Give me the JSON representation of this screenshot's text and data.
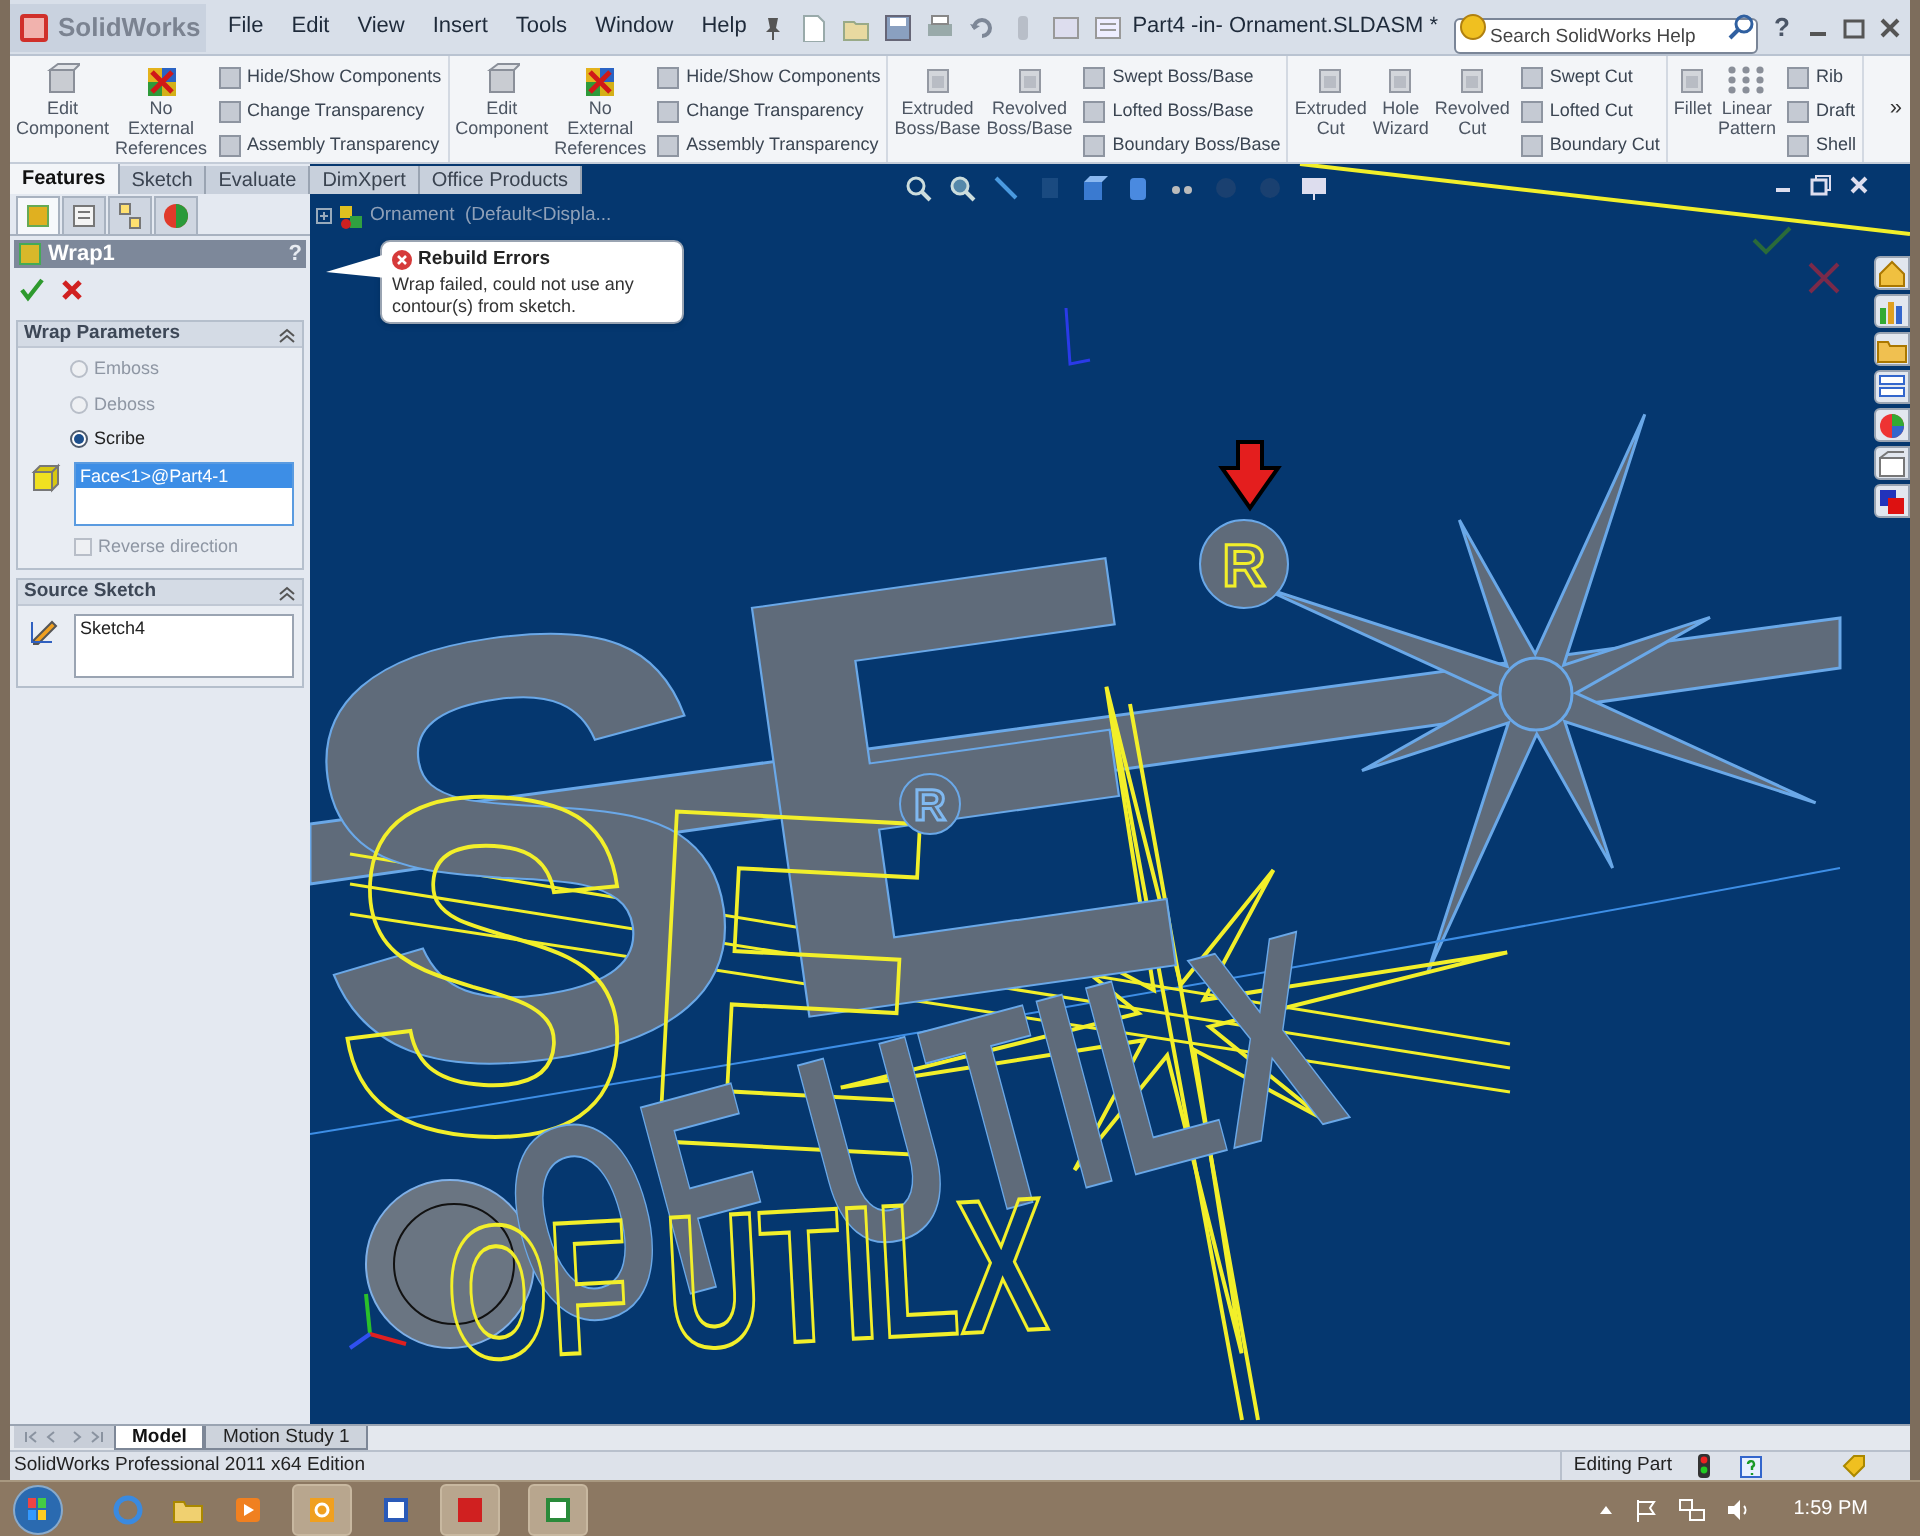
{
  "app": {
    "logo": "SolidWorks"
  },
  "menu": [
    "File",
    "Edit",
    "View",
    "Insert",
    "Tools",
    "Window",
    "Help"
  ],
  "window": {
    "title": "Part4 -in- Ornament.SLDASM *"
  },
  "search": {
    "placeholder": "Search SolidWorks Help"
  },
  "help_button": "?",
  "ribbon": {
    "groups": [
      {
        "items": [
          {
            "kind": "large",
            "label": "Edit Component"
          },
          {
            "kind": "large",
            "label": "No External References"
          },
          {
            "kind": "stack",
            "labels": [
              "Hide/Show Components",
              "Change Transparency",
              "Assembly Transparency"
            ]
          }
        ]
      },
      {
        "items": [
          {
            "kind": "large",
            "label": "Edit Component"
          },
          {
            "kind": "large",
            "label": "No External References"
          },
          {
            "kind": "stack",
            "labels": [
              "Hide/Show Components",
              "Change Transparency",
              "Assembly Transparency"
            ]
          }
        ]
      },
      {
        "items": [
          {
            "kind": "large",
            "label": "Extruded Boss/Base"
          },
          {
            "kind": "large",
            "label": "Revolved Boss/Base"
          },
          {
            "kind": "stack",
            "labels": [
              "Swept Boss/Base",
              "Lofted Boss/Base",
              "Boundary Boss/Base"
            ]
          }
        ]
      },
      {
        "items": [
          {
            "kind": "large",
            "label": "Extruded Cut"
          },
          {
            "kind": "large",
            "label": "Hole Wizard"
          },
          {
            "kind": "large",
            "label": "Revolved Cut"
          },
          {
            "kind": "stack",
            "labels": [
              "Swept Cut",
              "Lofted Cut",
              "Boundary Cut"
            ]
          }
        ]
      },
      {
        "items": [
          {
            "kind": "large",
            "label": "Fillet"
          },
          {
            "kind": "large",
            "label": "Linear Pattern"
          },
          {
            "kind": "stack",
            "labels": [
              "Rib",
              "Draft",
              "Shell"
            ]
          }
        ]
      }
    ],
    "more": "»"
  },
  "command_tabs": [
    {
      "label": "Features",
      "selected": true
    },
    {
      "label": "Sketch",
      "selected": false
    },
    {
      "label": "Evaluate",
      "selected": false
    },
    {
      "label": "DimXpert",
      "selected": false
    },
    {
      "label": "Office Products",
      "selected": false
    }
  ],
  "panel_tabs": [
    {
      "selected": true
    },
    {
      "selected": false
    },
    {
      "selected": false
    },
    {
      "selected": false
    }
  ],
  "property_manager": {
    "title": "Wrap1",
    "help": "?",
    "sections": [
      {
        "title": "Wrap Parameters",
        "radios": [
          {
            "label": "Emboss",
            "selected": false,
            "disabled": true
          },
          {
            "label": "Deboss",
            "selected": false,
            "disabled": true
          },
          {
            "label": "Scribe",
            "selected": true,
            "disabled": false
          }
        ],
        "list": [
          {
            "label": "Face<1>@Part4-1",
            "selected": true
          }
        ],
        "checkbox": {
          "label": "Reverse direction",
          "checked": false,
          "disabled": true
        }
      },
      {
        "title": "Source Sketch",
        "list": [
          {
            "label": "Sketch4",
            "selected": false
          }
        ]
      }
    ]
  },
  "tree_item": "Ornament  (Default<Displa...",
  "error_tooltip": {
    "title": "Rebuild Errors",
    "message": "Wrap failed, could not use any contour(s) from sketch."
  },
  "viewport": {
    "model_text": [
      {
        "text": "SE",
        "kind": "solid"
      },
      {
        "text": "SE",
        "kind": "outline"
      },
      {
        "text": "R",
        "kind": "badge"
      },
      {
        "text": "R",
        "kind": "badge"
      },
      {
        "text": "OF UTILX",
        "kind": "solid"
      },
      {
        "text": "OF UTILX",
        "kind": "outline"
      }
    ]
  },
  "bottom_tabs": [
    {
      "label": "Model",
      "selected": true
    },
    {
      "label": "Motion Study 1",
      "selected": false
    }
  ],
  "status_bar": {
    "product": "SolidWorks Professional 2011 x64 Edition",
    "mode": "Editing Part"
  },
  "taskbar": {
    "clock": "1:59 PM"
  }
}
